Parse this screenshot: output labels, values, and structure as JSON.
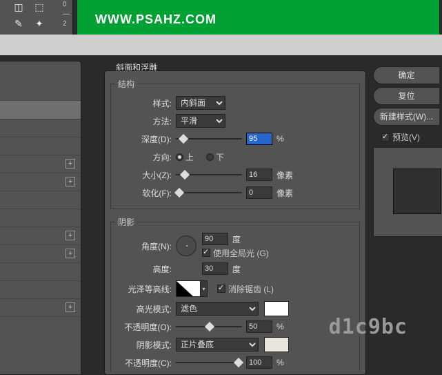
{
  "top": {
    "url": "WWW.PSAHZ.COM",
    "side": {
      "a": "0",
      "b": "—",
      "c": "2"
    }
  },
  "tab_title": "斜面和浮雕",
  "structure": {
    "legend": "结构",
    "style_label": "样式:",
    "style_value": "内斜面",
    "technique_label": "方法:",
    "technique_value": "平滑",
    "depth_label": "深度(D):",
    "depth_value": "95",
    "depth_unit": "%",
    "direction_label": "方向:",
    "direction_up": "上",
    "direction_down": "下",
    "size_label": "大小(Z):",
    "size_value": "16",
    "size_unit": "像素",
    "soften_label": "软化(F):",
    "soften_value": "0",
    "soften_unit": "像素"
  },
  "shading": {
    "legend": "阴影",
    "angle_label": "角度(N):",
    "angle_value": "90",
    "angle_unit": "度",
    "global_light": "使用全局光 (G)",
    "altitude_label": "高度:",
    "altitude_value": "30",
    "altitude_unit": "度",
    "gloss_label": "光泽等高线:",
    "antialias": "消除锯齿 (L)",
    "highlight_mode_label": "高光模式:",
    "highlight_mode_value": "滤色",
    "highlight_opacity_label": "不透明度(O):",
    "highlight_opacity_value": "50",
    "highlight_opacity_unit": "%",
    "shadow_mode_label": "阴影模式:",
    "shadow_mode_value": "正片叠底",
    "shadow_opacity_label": "不透明度(C):",
    "shadow_opacity_value": "100",
    "shadow_opacity_unit": "%",
    "highlight_color": "#ffffff",
    "shadow_color": "#e9e6dd"
  },
  "buttons": {
    "ok": "确定",
    "cancel": "复位",
    "new_style": "新建样式(W)...",
    "preview": "预览(V)"
  },
  "watermark": "d1c9bc"
}
